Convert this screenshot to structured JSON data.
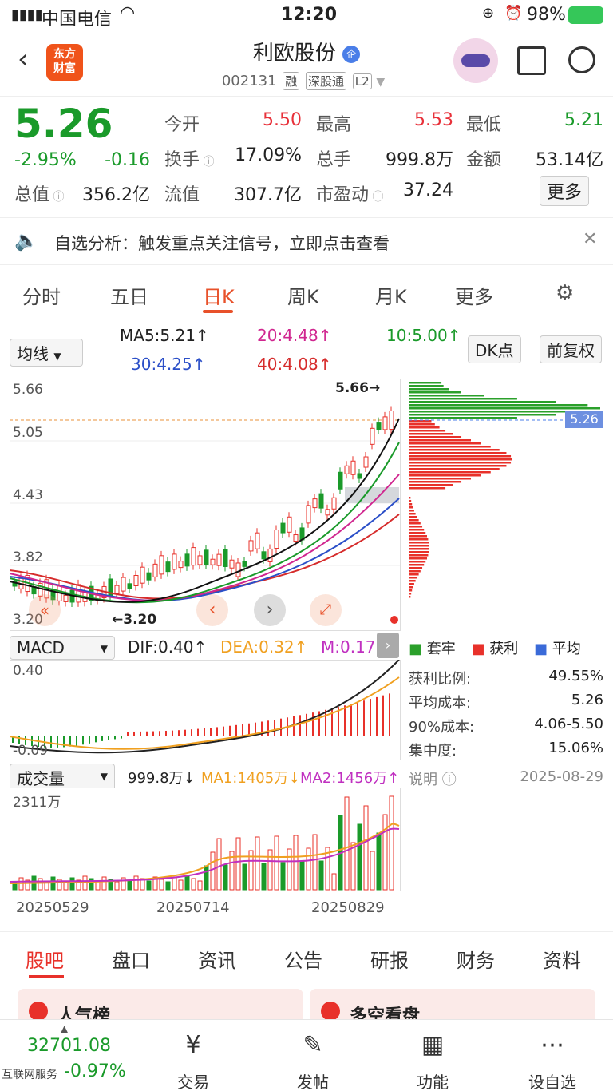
{
  "status_bar": {
    "carrier": "中国电信",
    "time": "12:20",
    "battery": "98%"
  },
  "header": {
    "title": "利欧股份",
    "title_badge": "企",
    "logo": "东方\n财富",
    "code": "002131",
    "tags": [
      "融",
      "深股通",
      "L2"
    ]
  },
  "quote": {
    "price": "5.26",
    "change_pct": "-2.95%",
    "change": "-0.16",
    "total_cap_label": "总值",
    "total_cap": "356.2亿",
    "rows": [
      [
        {
          "label": "今开",
          "value": "5.50",
          "color": "red"
        },
        {
          "label": "最高",
          "value": "5.53",
          "color": "red"
        },
        {
          "label": "最低",
          "value": "5.21",
          "color": "green"
        }
      ],
      [
        {
          "label": "换手",
          "value": "17.09%",
          "color": "dark"
        },
        {
          "label": "总手",
          "value": "999.8万",
          "color": "dark"
        },
        {
          "label": "金额",
          "value": "53.14亿",
          "color": "dark"
        }
      ],
      [
        {
          "label": "流值",
          "value": "307.7亿",
          "color": "dark"
        },
        {
          "label": "市盈动",
          "value": "37.24",
          "color": "dark"
        }
      ]
    ],
    "more_button": "更多"
  },
  "banner": {
    "text": "自选分析：触发重点关注信号，立即点击查看"
  },
  "chart_tabs": [
    "分时",
    "五日",
    "日K",
    "周K",
    "月K",
    "更多"
  ],
  "active_chart_tab": "日K",
  "ma_bar": {
    "selector": "均线",
    "ma5": "MA5:5.21↑",
    "ma20": "20:4.48↑",
    "ma10": "10:5.00↑",
    "ma30": "30:4.25↑",
    "ma40": "40:4.08↑",
    "dk_button": "DK点",
    "adjust_button": "前复权"
  },
  "kline": {
    "y_labels": [
      "5.66",
      "5.05",
      "4.43",
      "3.82",
      "3.20"
    ],
    "high_marker": "5.66→",
    "low_marker": "←3.20",
    "current_price_tag": "5.26"
  },
  "chip": {
    "legend": [
      "套牢",
      "获利",
      "平均"
    ],
    "stats": [
      {
        "label": "获利比例:",
        "value": "49.55%"
      },
      {
        "label": "平均成本:",
        "value": "5.26"
      },
      {
        "label": "90%成本:",
        "value": "4.06-5.50"
      },
      {
        "label": "集中度:",
        "value": "15.06%"
      }
    ],
    "note_label": "说明",
    "date": "2025-08-29"
  },
  "macd": {
    "selector": "MACD",
    "dif": "DIF:0.40↑",
    "dea": "DEA:0.32↑",
    "m": "M:0.17",
    "y_top": "0.40",
    "y_bottom": "-0.09"
  },
  "volume": {
    "selector": "成交量",
    "value": "999.8万↓",
    "ma1": "MA1:1405万↓",
    "ma2": "MA2:1456万↑",
    "y_top": "2311万",
    "dates": [
      "20250529",
      "20250714",
      "20250829"
    ]
  },
  "bottom_tabs": [
    "股吧",
    "盘口",
    "资讯",
    "公告",
    "研报",
    "财务",
    "资料"
  ],
  "cards": [
    "人气榜",
    "多空看盘"
  ],
  "footer": {
    "index_value": "32701.08",
    "index_label": "互联网服务",
    "index_change": "-0.97%",
    "tabs": [
      "交易",
      "发帖",
      "功能",
      "设自选"
    ]
  },
  "colors": {
    "up": "#e8312a",
    "down": "#1a9a2a",
    "accent": "#e8512a"
  }
}
